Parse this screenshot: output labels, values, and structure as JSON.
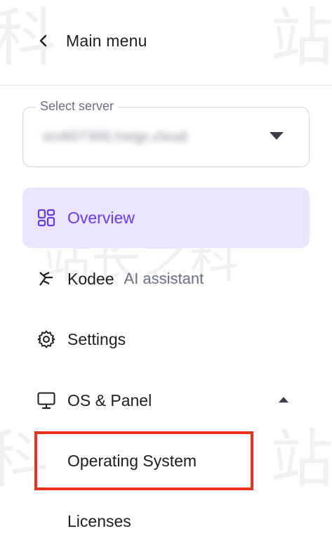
{
  "header": {
    "back_label": "Main menu",
    "back_icon": "chevron-left-icon"
  },
  "server_select": {
    "legend": "Select server",
    "value": "srv607300.hstgr.cloud",
    "blurred": true,
    "caret_icon": "caret-down-icon"
  },
  "nav": {
    "overview": {
      "label": "Overview",
      "icon": "grid-icon",
      "active": true
    },
    "kodee": {
      "label": "Kodee",
      "sublabel": "AI assistant",
      "icon": "kodee-sparkle-icon"
    },
    "settings": {
      "label": "Settings",
      "icon": "gear-icon"
    },
    "os_panel": {
      "label": "OS & Panel",
      "icon": "monitor-icon",
      "expanded": true,
      "items": [
        {
          "label": "Operating System",
          "highlighted": true
        },
        {
          "label": "Licenses"
        }
      ]
    }
  },
  "colors": {
    "accent": "#673de6",
    "active_bg": "#ebe4ff",
    "highlight_border": "#e8341c",
    "text_primary": "#1d1e20",
    "text_secondary": "#6d7081"
  }
}
